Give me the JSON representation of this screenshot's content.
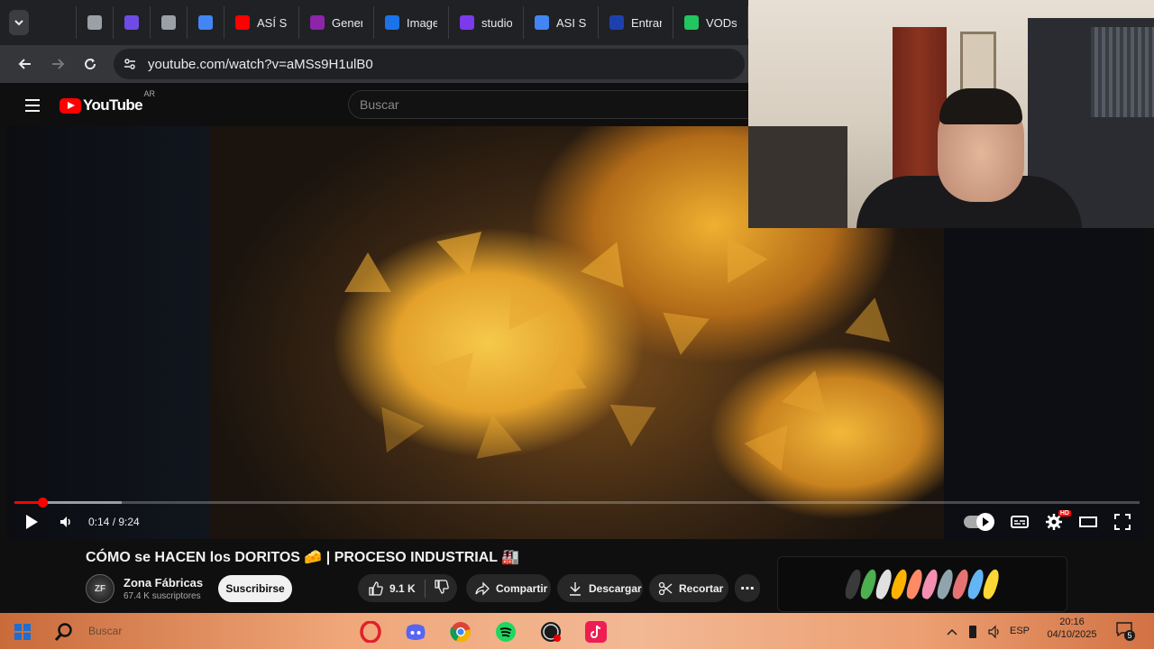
{
  "browser": {
    "tabs": [
      {
        "label": "",
        "color": "#202124"
      },
      {
        "label": "",
        "color": "#9aa0a6"
      },
      {
        "label": "",
        "color": "#6e4ce3"
      },
      {
        "label": "",
        "color": "#9aa0a6"
      },
      {
        "label": "",
        "color": "#4285f4"
      },
      {
        "label": "ASÍ SE",
        "color": "#ff0000"
      },
      {
        "label": "Gener",
        "color": "#8e24aa"
      },
      {
        "label": "Image",
        "color": "#1a73e8"
      },
      {
        "label": "studio",
        "color": "#7c3aed"
      },
      {
        "label": "ASI SE",
        "color": "#4285f4"
      },
      {
        "label": "Entrar",
        "color": "#1e40af"
      },
      {
        "label": "VODs",
        "color": "#22c55e"
      }
    ],
    "url": "youtube.com/watch?v=aMSs9H1ulB0"
  },
  "youtube": {
    "logo_text": "YouTube",
    "region": "AR",
    "search_placeholder": "Buscar"
  },
  "player": {
    "current_time": "0:14",
    "duration": "9:24",
    "time_display": "0:14 / 9:24",
    "played_fraction": 0.025,
    "loaded_fraction": 0.095,
    "hd_badge": "HD"
  },
  "video": {
    "title": "CÓMO se HACEN los DORITOS 🧀 | PROCESO INDUSTRIAL 🏭",
    "channel_name": "Zona Fábricas",
    "channel_avatar_text": "ZF",
    "subscribers": "67.4 K suscriptores",
    "subscribe_label": "Suscribirse",
    "likes": "9.1 K",
    "share_label": "Compartir",
    "download_label": "Descargar",
    "clip_label": "Recortar",
    "more_label": "⋯"
  },
  "taskbar": {
    "search_text": "Buscar",
    "language": "ESP",
    "time": "20:16",
    "date": "04/10/2025",
    "notifications": "5"
  },
  "colors": {
    "accent": "#ff0000",
    "background": "#0f0f0f",
    "pill": "#272727"
  }
}
